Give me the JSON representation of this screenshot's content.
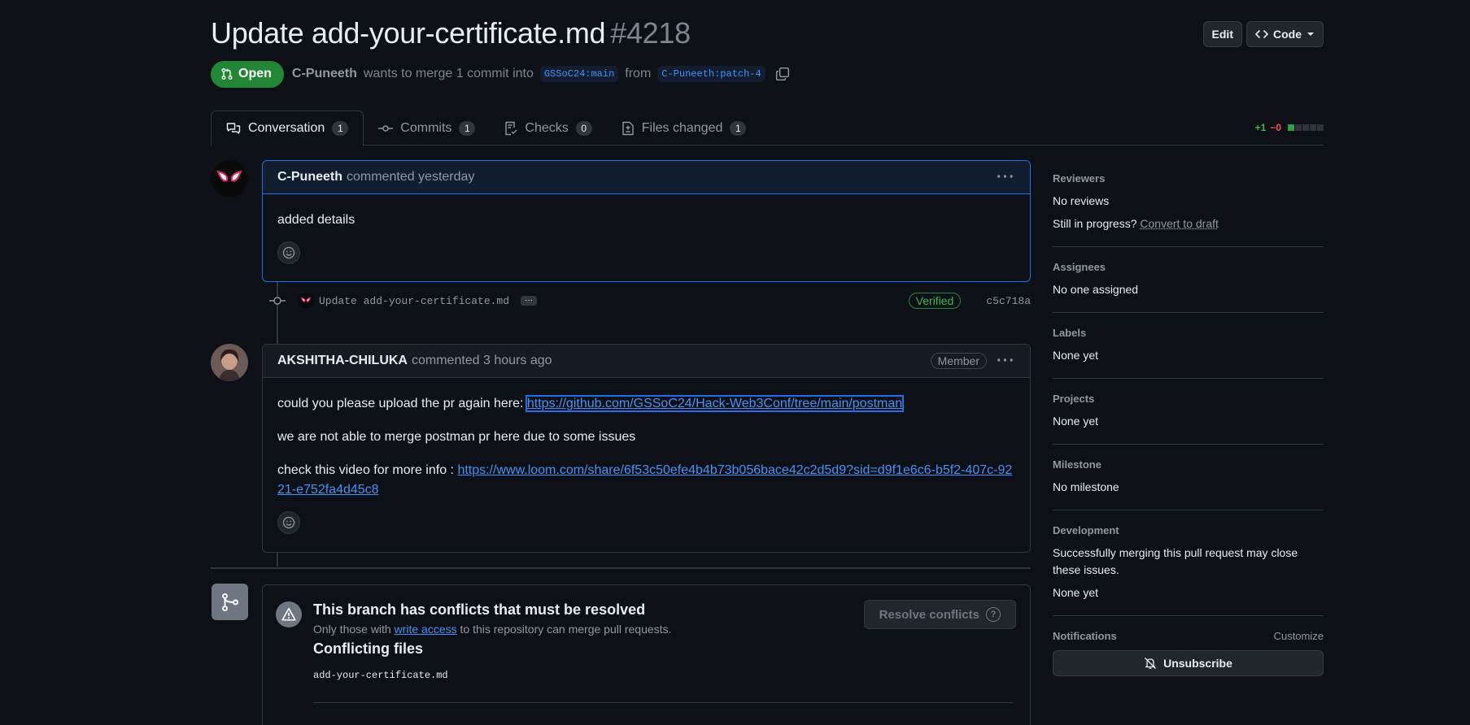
{
  "header": {
    "title": "Update add-your-certificate.md",
    "number": "#4218",
    "edit_label": "Edit",
    "code_label": "Code"
  },
  "meta": {
    "state": "Open",
    "author": "C-Puneeth",
    "text_merge": "wants to merge 1 commit into",
    "base_branch": "GSSoC24:main",
    "text_from": "from",
    "head_branch": "C-Puneeth:patch-4"
  },
  "tabs": [
    {
      "label": "Conversation",
      "count": "1"
    },
    {
      "label": "Commits",
      "count": "1"
    },
    {
      "label": "Checks",
      "count": "0"
    },
    {
      "label": "Files changed",
      "count": "1"
    }
  ],
  "diffstat": {
    "additions": "+1",
    "deletions": "−0"
  },
  "comment1": {
    "author": "C-Puneeth",
    "action": "commented yesterday",
    "body": "added details"
  },
  "commit": {
    "message": "Update add-your-certificate.md",
    "verified": "Verified",
    "sha": "c5c718a"
  },
  "comment2": {
    "author": "AKSHITHA-CHILUKA",
    "action": "commented 3 hours ago",
    "badge": "Member",
    "p1_text": "could you please upload the pr again here: ",
    "p1_link": "https://github.com/GSSoC24/Hack-Web3Conf/tree/main/postman",
    "p2_text": "we are not able to merge postman pr here due to some issues",
    "p3_text": "check this video for more info : ",
    "p3_link": "https://www.loom.com/share/6f53c50efe4b4b73b056bace42c2d5d9?sid=d9f1e6c6-b5f2-407c-9221-e752fa4d45c8"
  },
  "merge_box": {
    "title": "This branch has conflicts that must be resolved",
    "sub_before": "Only those with ",
    "sub_link": "write access",
    "sub_after": " to this repository can merge pull requests.",
    "resolve_label": "Resolve conflicts",
    "conflicting_title": "Conflicting files",
    "file": "add-your-certificate.md"
  },
  "sidebar": {
    "reviewers": {
      "heading": "Reviewers",
      "value": "No reviews",
      "in_progress": "Still in progress?",
      "convert": "Convert to draft"
    },
    "assignees": {
      "heading": "Assignees",
      "value": "No one assigned"
    },
    "labels": {
      "heading": "Labels",
      "value": "None yet"
    },
    "projects": {
      "heading": "Projects",
      "value": "None yet"
    },
    "milestone": {
      "heading": "Milestone",
      "value": "No milestone"
    },
    "development": {
      "heading": "Development",
      "text": "Successfully merging this pull request may close these issues.",
      "value": "None yet"
    },
    "notifications": {
      "heading": "Notifications",
      "customize": "Customize",
      "unsubscribe": "Unsubscribe"
    }
  },
  "colors": {
    "open_state": "#238636",
    "accent": "#4493f8",
    "bg": "#0d1117"
  }
}
